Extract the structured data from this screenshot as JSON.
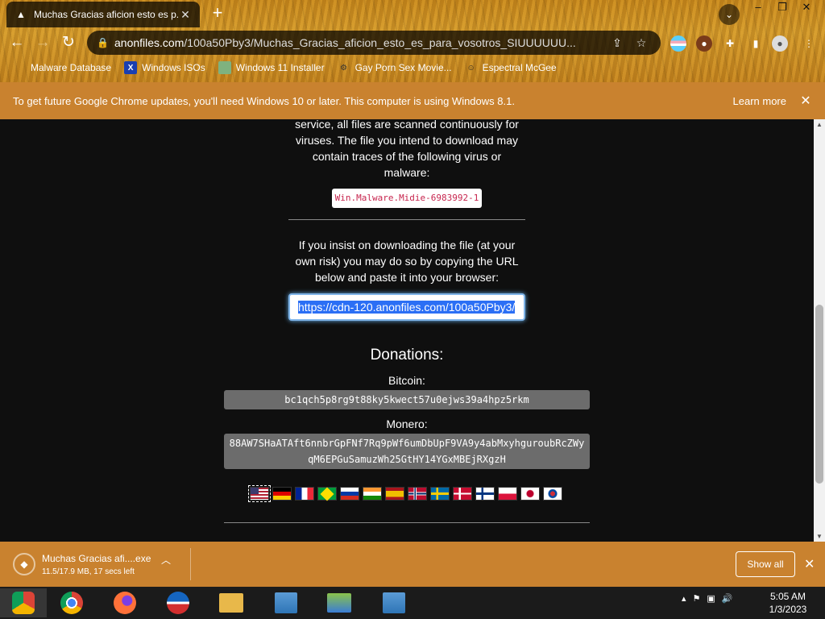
{
  "browser": {
    "tab_title": "Muchas Gracias aficion esto es p...",
    "new_tab": "+",
    "url_host": "anonfiles.com",
    "url_path": "/100a50Pby3/Muchas_Gracias_aficion_esto_es_para_vosotros_SIUUUUUU...",
    "bookmarks": [
      {
        "label": "Malware Database",
        "icon": "generic-icon"
      },
      {
        "label": "Windows ISOs",
        "icon": "x-icon"
      },
      {
        "label": "Windows 11 Installer",
        "icon": "image-icon"
      },
      {
        "label": "Gay Porn Sex Movie...",
        "icon": "site-icon"
      },
      {
        "label": "Espectral McGee",
        "icon": "avatar-icon"
      }
    ]
  },
  "infobar": {
    "message": "To get future Google Chrome updates, you'll need Windows 10 or later. This computer is using Windows 8.1.",
    "learn_more": "Learn more"
  },
  "page": {
    "virus_text": "service, all files are scanned continuously for viruses. The file you intend to download may contain traces of the following virus or malware:",
    "virus_name": "Win.Malware.Midie-6983992-1",
    "insist_text": "If you insist on downloading the file (at your own risk) you may do so by copying the URL below and paste it into your browser:",
    "download_url": "https://cdn-120.anonfiles.com/100a50Pby3/",
    "donations_title": "Donations:",
    "bitcoin_label": "Bitcoin:",
    "bitcoin_address": "bc1qch5p8rg9t88ky5kwect57u0ejws39a4hpz5rkm",
    "monero_label": "Monero:",
    "monero_address": "88AW7SHaATAft6nnbrGpFNf7Rq9pWf6umDbUpF9VA9y4abMxyhguroubRcZWyqM6EPGuSamuzWh25GtHY14YGxMBEjRXgzH",
    "flags": [
      "us",
      "de",
      "fr",
      "br",
      "ru",
      "in",
      "es",
      "no",
      "se",
      "dk",
      "fi",
      "pl",
      "jp",
      "kr"
    ]
  },
  "download_bar": {
    "file_name": "Muchas Gracias afi....exe",
    "progress": "11.5/17.9 MB, 17 secs left",
    "show_all": "Show all"
  },
  "taskbar": {
    "time": "5:05 AM",
    "date": "1/3/2023"
  }
}
